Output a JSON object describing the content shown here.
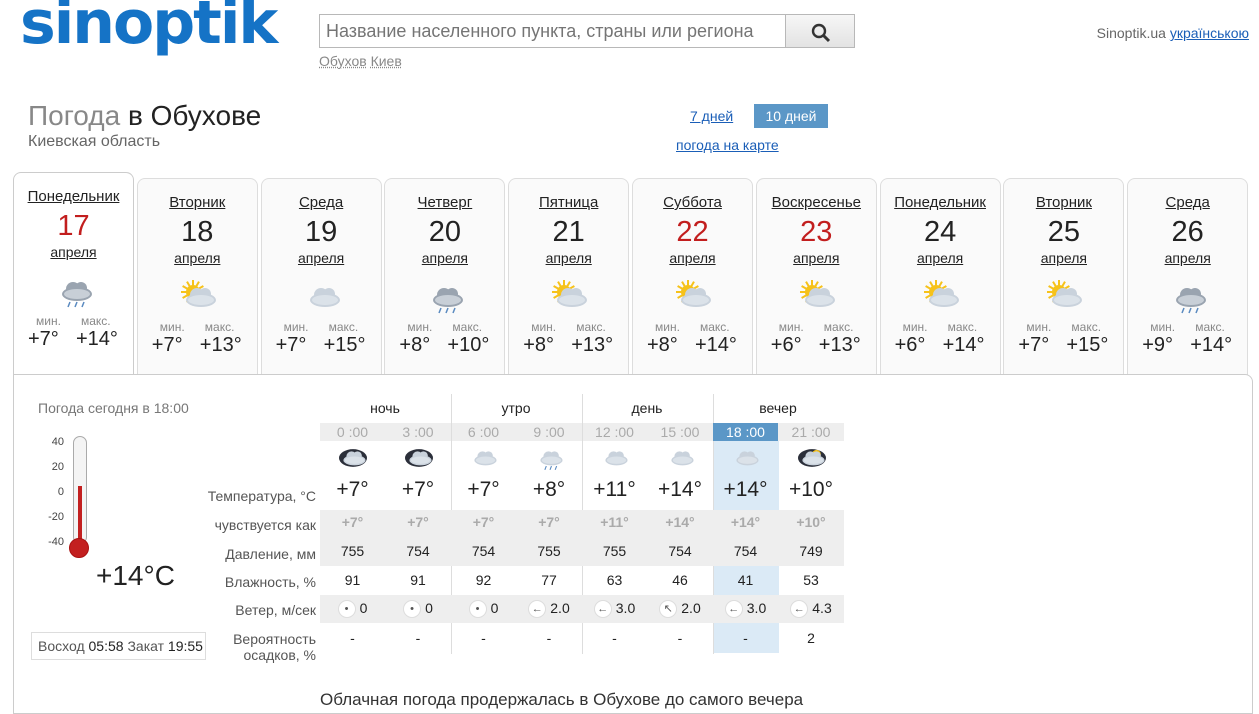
{
  "header": {
    "logo": "sinoptik",
    "search_placeholder": "Название населенного пункта, страны или региона",
    "recent": [
      "Обухов",
      "Киев"
    ],
    "site": "Sinoptik.ua",
    "lang": "українською"
  },
  "title": {
    "prefix": "Погода",
    "city": "в Обухове",
    "region": "Киевская область"
  },
  "period": {
    "days7": "7 дней",
    "days10": "10 дней",
    "map": "погода на карте"
  },
  "days": [
    {
      "name": "Понедельник",
      "date": "17",
      "month": "апреля",
      "min": "+7°",
      "max": "+14°",
      "icon": "cloud-rain-icon",
      "red": true,
      "active": true
    },
    {
      "name": "Вторник",
      "date": "18",
      "month": "апреля",
      "min": "+7°",
      "max": "+13°",
      "icon": "sun-cloud-icon"
    },
    {
      "name": "Среда",
      "date": "19",
      "month": "апреля",
      "min": "+7°",
      "max": "+15°",
      "icon": "cloud-icon"
    },
    {
      "name": "Четверг",
      "date": "20",
      "month": "апреля",
      "min": "+8°",
      "max": "+10°",
      "icon": "cloud-rain-icon"
    },
    {
      "name": "Пятница",
      "date": "21",
      "month": "апреля",
      "min": "+8°",
      "max": "+13°",
      "icon": "sun-cloud-icon"
    },
    {
      "name": "Суббота",
      "date": "22",
      "month": "апреля",
      "min": "+8°",
      "max": "+14°",
      "icon": "sun-cloud-icon",
      "red": true
    },
    {
      "name": "Воскресенье",
      "date": "23",
      "month": "апреля",
      "min": "+6°",
      "max": "+13°",
      "icon": "sun-cloud-icon",
      "red": true
    },
    {
      "name": "Понедельник",
      "date": "24",
      "month": "апреля",
      "min": "+6°",
      "max": "+14°",
      "icon": "sun-cloud-icon"
    },
    {
      "name": "Вторник",
      "date": "25",
      "month": "апреля",
      "min": "+7°",
      "max": "+15°",
      "icon": "sun-cloud-icon"
    },
    {
      "name": "Среда",
      "date": "26",
      "month": "апреля",
      "min": "+9°",
      "max": "+14°",
      "icon": "cloud-rain-icon"
    }
  ],
  "minmax": {
    "min": "мин.",
    "max": "макс."
  },
  "today": {
    "label": "Погода сегодня в 18:00",
    "temp": "+14°C",
    "scale": [
      "40",
      "20",
      "0",
      "-20",
      "-40"
    ],
    "level": 0.54,
    "sunrise_label": "Восход",
    "sunrise": "05:58",
    "sunset_label": "Закат",
    "sunset": "19:55"
  },
  "table": {
    "periods": [
      "ночь",
      "утро",
      "день",
      "вечер"
    ],
    "hours": [
      "0 :00",
      "3 :00",
      "6 :00",
      "9 :00",
      "12 :00",
      "15 :00",
      "18 :00",
      "21 :00"
    ],
    "icons": [
      "night-cloud-icon",
      "night-cloud-icon",
      "cloud-icon",
      "cloud-drizzle-icon",
      "cloud-icon",
      "cloud-icon",
      "cloud-icon",
      "night-cloud-moon-icon"
    ],
    "labels": {
      "temp": "Температура, °C",
      "feels": "чувствуется как",
      "pressure": "Давление, мм",
      "humidity": "Влажность, %",
      "wind": "Ветер, м/сек",
      "precip1": "Вероятность",
      "precip2": "осадков, %"
    },
    "temp": [
      "+7°",
      "+7°",
      "+7°",
      "+8°",
      "+11°",
      "+14°",
      "+14°",
      "+10°"
    ],
    "feels": [
      "+7°",
      "+7°",
      "+7°",
      "+7°",
      "+11°",
      "+14°",
      "+14°",
      "+10°"
    ],
    "pressure": [
      "755",
      "754",
      "754",
      "755",
      "755",
      "754",
      "754",
      "749"
    ],
    "humidity": [
      "91",
      "91",
      "92",
      "77",
      "63",
      "46",
      "41",
      "53"
    ],
    "wind_dir": [
      "•",
      "•",
      "•",
      "←",
      "←",
      "↖",
      "←",
      "←"
    ],
    "wind": [
      "0",
      "0",
      "0",
      "2.0",
      "3.0",
      "2.0",
      "3.0",
      "4.3"
    ],
    "precip": [
      "-",
      "-",
      "-",
      "-",
      "-",
      "-",
      "-",
      "2"
    ]
  },
  "description": "Облачная погода продержалась в Обухове до самого вечера"
}
